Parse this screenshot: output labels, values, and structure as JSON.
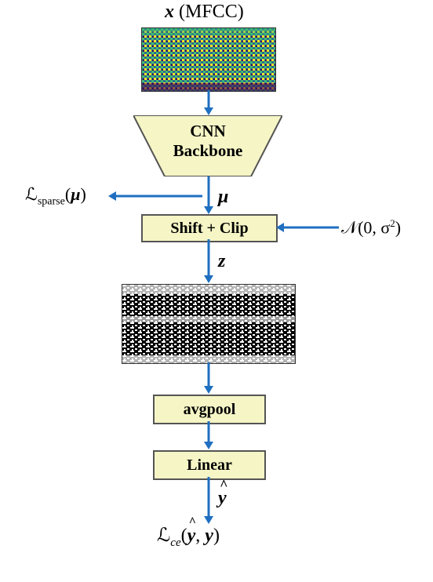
{
  "input": {
    "symbol": "x",
    "annotation": "(MFCC)"
  },
  "blocks": {
    "cnn": {
      "line1": "CNN",
      "line2": "Backbone"
    },
    "shiftclip": "Shift + Clip",
    "avgpool": "avgpool",
    "linear": "Linear"
  },
  "symbols": {
    "mu": "μ",
    "z": "z",
    "yhat": "ŷ"
  },
  "side_labels": {
    "sparse_loss": "ℒ_sparse(μ)",
    "noise": "𝒩(0, σ²)"
  },
  "output_loss": "ℒ_ce(ŷ, y)",
  "chart_data": {
    "type": "diagram",
    "description": "Neural network architecture flow diagram",
    "nodes": [
      {
        "id": "input",
        "label": "x (MFCC)",
        "type": "input-spectrogram"
      },
      {
        "id": "cnn",
        "label": "CNN Backbone",
        "type": "trapezoid-block"
      },
      {
        "id": "mu",
        "label": "μ",
        "type": "tensor"
      },
      {
        "id": "shiftclip",
        "label": "Shift + Clip",
        "type": "block"
      },
      {
        "id": "z",
        "label": "z",
        "type": "tensor"
      },
      {
        "id": "binary",
        "label": "binary feature map",
        "type": "image"
      },
      {
        "id": "avgpool",
        "label": "avgpool",
        "type": "block"
      },
      {
        "id": "linear",
        "label": "Linear",
        "type": "block"
      },
      {
        "id": "yhat",
        "label": "ŷ",
        "type": "tensor"
      },
      {
        "id": "loss_ce",
        "label": "ℒ_ce(ŷ, y)",
        "type": "loss"
      },
      {
        "id": "loss_sparse",
        "label": "ℒ_sparse(μ)",
        "type": "side-loss"
      },
      {
        "id": "noise",
        "label": "𝒩(0, σ²)",
        "type": "side-input"
      }
    ],
    "edges": [
      {
        "from": "input",
        "to": "cnn"
      },
      {
        "from": "cnn",
        "to": "mu"
      },
      {
        "from": "mu",
        "to": "shiftclip"
      },
      {
        "from": "mu",
        "to": "loss_sparse"
      },
      {
        "from": "noise",
        "to": "shiftclip"
      },
      {
        "from": "shiftclip",
        "to": "z"
      },
      {
        "from": "z",
        "to": "binary"
      },
      {
        "from": "binary",
        "to": "avgpool"
      },
      {
        "from": "avgpool",
        "to": "linear"
      },
      {
        "from": "linear",
        "to": "yhat"
      },
      {
        "from": "yhat",
        "to": "loss_ce"
      }
    ]
  }
}
